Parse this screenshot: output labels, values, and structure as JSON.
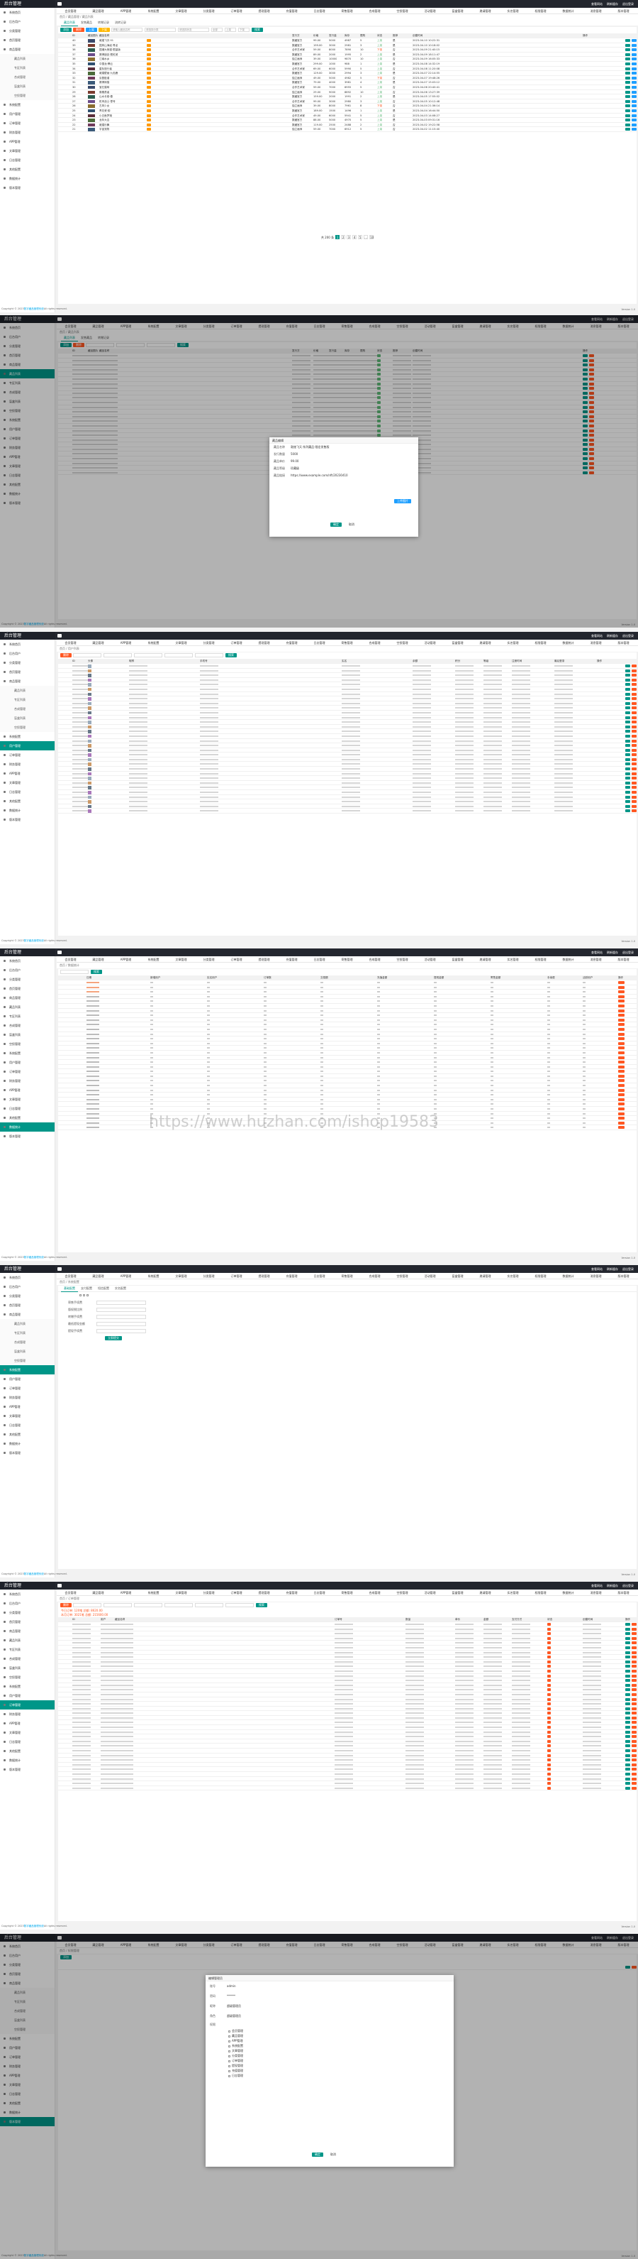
{
  "app": {
    "brand": "后台管理",
    "top_right": [
      "查看网站",
      "刷新缓存",
      "退出登录"
    ],
    "footer_prefix": "Copyright © 2023",
    "footer_link": "数字藏品管理系统",
    "footer_suffix": "All rights reserved.",
    "version": "Version 1.0"
  },
  "nav_tabs": [
    "会员管理",
    "藏品管理",
    "APP管理",
    "系统配置",
    "文章管理",
    "分类管理",
    "订单管理",
    "提现管理",
    "充值管理",
    "日志管理",
    "寄售管理",
    "合成管理",
    "空投管理",
    "活动管理",
    "盲盒管理",
    "邀请管理",
    "实名管理",
    "权限管理",
    "数据统计",
    "消息管理",
    "版本管理"
  ],
  "sidebar": [
    "系统首页",
    "后台用户",
    "分类管理",
    "首页管理",
    "商品管理",
    "藏品列表",
    "专区列表",
    "合成管理",
    "盲盒列表",
    "空投管理",
    "系统配置",
    "用户管理",
    "订单管理",
    "财务管理",
    "APP管理",
    "文章管理",
    "日志管理",
    "其他配置",
    "数据统计",
    "版本管理"
  ],
  "watermark": "https://www.huzhan.com/ishop19583",
  "s1": {
    "breadcrumb": "首页 / 藏品管理 / 藏品列表",
    "tabs": [
      "藏品列表",
      "发售藏品",
      "转赠记录",
      "流转记录"
    ],
    "toolbar": {
      "add": "添加",
      "del": "删除",
      "up": "上架",
      "down": "下架",
      "search": "搜索"
    },
    "filters": [
      "请输入藏品名称",
      "请选择分类",
      "请选择状态",
      "全部",
      "上架",
      "下架"
    ],
    "columns": [
      "ID",
      "藏品图片",
      "藏品名称",
      "发行方",
      "价格",
      "发行量",
      "库存",
      "限购",
      "状态",
      "推荐",
      "创建时间",
      "操作"
    ],
    "rows": [
      [
        "40",
        "敦煌飞天·01",
        "数藏官方",
        "99.00",
        "5000",
        "4987",
        "5",
        "上架",
        "是",
        "2023-04-10 10:22:31"
      ],
      [
        "39",
        "国风山海经·青龙",
        "数藏官方",
        "199.00",
        "3000",
        "2981",
        "3",
        "上架",
        "是",
        "2023-04-10 10:18:02"
      ],
      [
        "38",
        "国潮大熊猫·限量版",
        "合作艺术家",
        "59.00",
        "8000",
        "7890",
        "10",
        "下架",
        "否",
        "2023-04-09 21:40:15"
      ],
      [
        "37",
        "赛博朋克·霓虹城",
        "数藏官方",
        "89.00",
        "2000",
        "1995",
        "2",
        "上架",
        "是",
        "2023-04-09 18:11:47"
      ],
      [
        "36",
        "江南水乡",
        "独立画师",
        "39.00",
        "10000",
        "9870",
        "10",
        "上架",
        "否",
        "2023-04-09 16:05:33"
      ],
      [
        "35",
        "中国龙·腾云",
        "数藏官方",
        "299.00",
        "1000",
        "988",
        "1",
        "上架",
        "是",
        "2023-04-08 14:32:19"
      ],
      [
        "34",
        "星际旅行者",
        "合作艺术家",
        "69.00",
        "6000",
        "5990",
        "5",
        "上架",
        "否",
        "2023-04-08 11:20:08"
      ],
      [
        "33",
        "敦煌壁画·九色鹿",
        "数藏官方",
        "129.00",
        "3000",
        "2994",
        "3",
        "上架",
        "是",
        "2023-04-07 22:14:55"
      ],
      [
        "32",
        "京剧脸谱",
        "独立画师",
        "49.00",
        "5000",
        "4982",
        "5",
        "下架",
        "否",
        "2023-04-07 19:48:26"
      ],
      [
        "31",
        "赛博熊猫",
        "数藏官方",
        "79.00",
        "4000",
        "3981",
        "4",
        "上架",
        "是",
        "2023-04-07 15:03:12"
      ],
      [
        "30",
        "宝石猫咪",
        "合作艺术家",
        "59.00",
        "7000",
        "6955",
        "5",
        "上架",
        "否",
        "2023-04-06 20:40:41"
      ],
      [
        "29",
        "像素勇者",
        "独立画师",
        "29.00",
        "9000",
        "8892",
        "10",
        "上架",
        "否",
        "2023-04-06 13:27:39"
      ],
      [
        "28",
        "山水长卷·春",
        "数藏官方",
        "159.00",
        "2000",
        "1991",
        "2",
        "上架",
        "是",
        "2023-04-05 17:55:02"
      ],
      [
        "27",
        "机甲战士·零号",
        "合作艺术家",
        "99.00",
        "3000",
        "2980",
        "3",
        "上架",
        "否",
        "2023-04-05 10:12:48"
      ],
      [
        "26",
        "古风少女",
        "独立画师",
        "39.00",
        "8000",
        "7961",
        "8",
        "下架",
        "否",
        "2023-04-04 21:36:14"
      ],
      [
        "25",
        "青花瓷·韵",
        "数藏官方",
        "189.00",
        "1500",
        "1496",
        "1",
        "上架",
        "是",
        "2023-04-04 16:44:50"
      ],
      [
        "24",
        "小丑鱼梦境",
        "合作艺术家",
        "49.00",
        "6000",
        "5941",
        "5",
        "上架",
        "否",
        "2023-04-03 14:08:27"
      ],
      [
        "23",
        "龙年大吉",
        "数藏官方",
        "88.00",
        "5000",
        "4970",
        "5",
        "上架",
        "是",
        "2023-04-03 09:31:16"
      ],
      [
        "22",
        "敦煌乐舞",
        "数藏官方",
        "119.00",
        "2500",
        "2488",
        "2",
        "上架",
        "否",
        "2023-04-02 19:22:58"
      ],
      [
        "21",
        "宇宙宠物",
        "独立画师",
        "59.00",
        "7000",
        "6912",
        "5",
        "上架",
        "否",
        "2023-04-02 11:15:40"
      ]
    ],
    "pager": [
      "1",
      "2",
      "3",
      "4",
      "5",
      "...",
      "10"
    ],
    "pager_info": "共 200 条"
  },
  "s2": {
    "breadcrumb": "首页 / 藏品列表",
    "tabs": [
      "藏品列表",
      "发售藏品",
      "转赠记录"
    ],
    "modal_title": "藏品编辑",
    "fields": [
      [
        "藏品名称",
        "敦煌飞天·系列藏品·限定发售版"
      ],
      [
        "发行数量",
        "5000"
      ],
      [
        "藏品单价",
        "99.00"
      ],
      [
        "藏品等级",
        "珍藏级"
      ],
      [
        "藏品链接",
        "https://www.example.com/nft/20230410"
      ]
    ],
    "upload": "上传图片",
    "confirm": "确定",
    "cancel": "取消"
  },
  "s3": {
    "breadcrumb": "首页 / 用户列表",
    "search": "搜索",
    "columns": [
      "ID",
      "头像",
      "昵称",
      "手机号",
      "实名",
      "余额",
      "积分",
      "等级",
      "注册时间",
      "最后登录",
      "操作"
    ]
  },
  "s4": {
    "breadcrumb": "首页 / 数据统计",
    "columns": [
      "日期",
      "新增用户",
      "实名用户",
      "订单数",
      "交易额",
      "充值金额",
      "提现金额",
      "寄售金额",
      "手续费",
      "活跃用户",
      "操作"
    ]
  },
  "s5": {
    "breadcrumb": "首页 / 系统配置",
    "tabs": [
      "基础配置",
      "支付配置",
      "短信配置",
      "实名配置"
    ],
    "fields": [
      [
        "寄售手续费",
        ""
      ],
      [
        "版权税比例",
        ""
      ],
      [
        "转赠手续费",
        ""
      ],
      [
        "最低提现金额",
        ""
      ],
      [
        "提现手续费",
        ""
      ]
    ],
    "submit": "立即提交"
  },
  "s6": {
    "breadcrumb": "首页 / 订单管理",
    "stats": [
      "今日订单: 120笔  总额: 8620.00",
      "本月订单: 3021笔  总额: 215600.00"
    ],
    "columns": [
      "ID",
      "用户",
      "藏品名称",
      "订单号",
      "数量",
      "单价",
      "金额",
      "支付方式",
      "状态",
      "创建时间",
      "操作"
    ]
  },
  "s7": {
    "breadcrumb": "首页 / 权限管理",
    "add": "添加",
    "modal_title": "编辑管理员",
    "fields": [
      [
        "账号",
        "admin"
      ],
      [
        "密码",
        "******"
      ],
      [
        "昵称",
        "超级管理员"
      ],
      [
        "角色",
        "超级管理员"
      ]
    ],
    "perm_label": "权限",
    "perms": [
      "会员管理",
      "藏品管理",
      "APP管理",
      "系统配置",
      "文章管理",
      "分类管理",
      "订单管理",
      "提现管理",
      "充值管理",
      "日志管理"
    ],
    "confirm": "确定",
    "cancel": "取消"
  }
}
